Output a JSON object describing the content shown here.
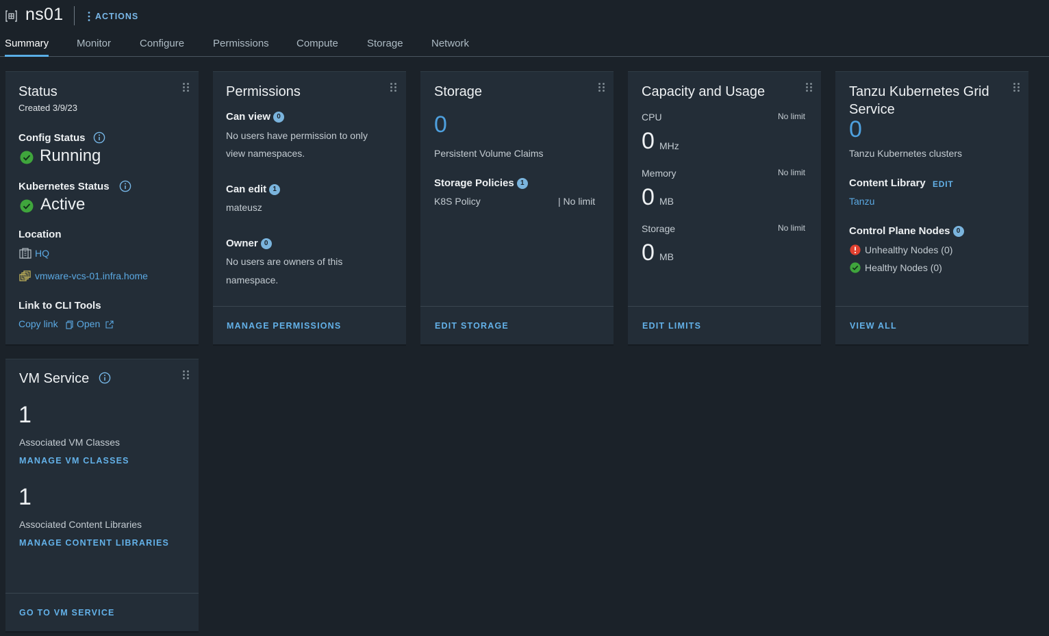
{
  "header": {
    "namespace": "ns01",
    "actions_label": "ACTIONS"
  },
  "tabs": [
    {
      "label": "Summary",
      "active": true
    },
    {
      "label": "Monitor"
    },
    {
      "label": "Configure"
    },
    {
      "label": "Permissions"
    },
    {
      "label": "Compute"
    },
    {
      "label": "Storage"
    },
    {
      "label": "Network"
    }
  ],
  "status": {
    "title": "Status",
    "created": "Created 3/9/23",
    "config_label": "Config Status",
    "config_value": "Running",
    "k8s_label": "Kubernetes Status",
    "k8s_value": "Active",
    "location_label": "Location",
    "location_dc": "HQ",
    "location_vc": "vmware-vcs-01.infra.home",
    "cli_label": "Link to CLI Tools",
    "copy_link": "Copy link",
    "open": "Open"
  },
  "permissions": {
    "title": "Permissions",
    "can_view_label": "Can view",
    "can_view_count": "0",
    "can_view_text_1": "No users have permission to only",
    "can_view_text_2": "view namespaces.",
    "can_edit_label": "Can edit",
    "can_edit_count": "1",
    "can_edit_user": "mateusz",
    "owner_label": "Owner",
    "owner_count": "0",
    "owner_text_1": "No users are owners of this",
    "owner_text_2": "namespace.",
    "footer": "MANAGE PERMISSIONS"
  },
  "storage": {
    "title": "Storage",
    "pvc_count": "0",
    "pvc_label": "Persistent Volume Claims",
    "policies_label": "Storage Policies",
    "policies_count": "1",
    "policy_name": "K8S Policy",
    "policy_limit": "| No limit",
    "footer": "EDIT STORAGE"
  },
  "capacity": {
    "title": "Capacity and Usage",
    "cpu_label": "CPU",
    "cpu_limit": "No limit",
    "cpu_value": "0",
    "cpu_unit": "MHz",
    "mem_label": "Memory",
    "mem_limit": "No limit",
    "mem_value": "0",
    "mem_unit": "MB",
    "stor_label": "Storage",
    "stor_limit": "No limit",
    "stor_value": "0",
    "stor_unit": "MB",
    "footer": "EDIT LIMITS"
  },
  "tkg": {
    "title_1": "Tanzu Kubernetes Grid",
    "title_2": "Service",
    "clusters_count": "0",
    "clusters_label": "Tanzu Kubernetes clusters",
    "content_lib_label": "Content Library",
    "content_lib_edit": "EDIT",
    "content_lib_name": "Tanzu",
    "cp_label": "Control Plane Nodes",
    "cp_count": "0",
    "unhealthy": "Unhealthy Nodes (0)",
    "healthy": "Healthy Nodes (0)",
    "footer": "VIEW ALL"
  },
  "vm_service": {
    "title": "VM Service",
    "vm_classes_count": "1",
    "vm_classes_label": "Associated VM Classes",
    "vm_classes_link": "MANAGE VM CLASSES",
    "content_libs_count": "1",
    "content_libs_label": "Associated Content Libraries",
    "content_libs_link": "MANAGE CONTENT LIBRARIES",
    "footer": "GO TO VM SERVICE"
  },
  "colors": {
    "accent": "#5ba9e3",
    "ok": "#3fa53c",
    "error": "#e0402f",
    "background": "#1b2229",
    "card": "#232d37"
  }
}
